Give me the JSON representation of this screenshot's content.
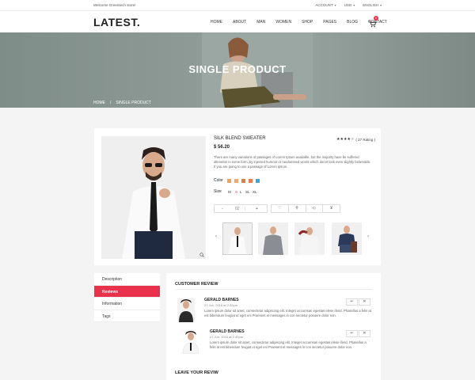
{
  "topbar": {
    "welcome": "Welcome Greentech store!",
    "account": "ACCOUNT",
    "currency": "USD",
    "language": "ENGLISH"
  },
  "header": {
    "logo": "LATEST.",
    "nav": [
      "HOME",
      "ABOUT",
      "MAN",
      "WOMEN",
      "SHOP",
      "PAGES",
      "BLOG",
      "CONTACT"
    ],
    "cart_count": "0"
  },
  "hero": {
    "title": "SINGLE PRODUCT",
    "breadcrumb": [
      "HOME",
      "/",
      "SINGLE PRODUCT"
    ]
  },
  "product": {
    "name": "SILK BLEND SWEATER",
    "price": "$ 56.20",
    "rating_text": "( 27 Rating )",
    "rating": 4,
    "description": "There are many variations of passages of Lorem Ipsum available, but the majority have be suffered alteration in some form, by injected humour or randomised words which donot look even slightly believable. If you are going to use a passage of Lorem Ipsum.",
    "color_label": "Color",
    "colors": [
      "#f0a05a",
      "#e9a87a",
      "#e08040",
      "#f27a4f",
      "#3aa6e0"
    ],
    "size_label": "Size",
    "sizes": [
      "M",
      "S",
      "L",
      "SL",
      "XL"
    ],
    "active_size": "S",
    "qty_minus": "-",
    "qty_value": "02",
    "qty_plus": "+",
    "action_icons": [
      "heart-icon",
      "search-icon",
      "tag-icon",
      "cart-icon"
    ]
  },
  "tabs": [
    "Description",
    "Reviews",
    "Information",
    "Tags"
  ],
  "active_tab": "Reviews",
  "reviews": {
    "heading": "CUSTOMER REVIEW",
    "items": [
      {
        "name": "GERALD BARNES",
        "date": "27 Jun, 2016 at 2:30pm",
        "text": "Lorem ipsum dolor sit amet, consectetur adipiscing elit. Integer accumsan egestas elese ifend. Phasellus a felis at est bibendum feugiat ut eget eni Praesent et messages in con sectetur posuere dolor non."
      },
      {
        "name": "GERALD BARNES",
        "date": "27 Jun, 2016 at 2:30pm",
        "text": "Lorem ipsum dolor sit amet, consectetur adipiscing elit. Integer accumsan egestas elese ifend. Phasellus a felis at est bibendum feugiat ut eget eni Praesent et messages in con sectetur posuere dolor non."
      }
    ],
    "reply_label": "↩",
    "close_label": "✕",
    "leave_heading": "LEAVE YOUR REVIW"
  },
  "colors": {
    "accent": "#e9314c"
  }
}
